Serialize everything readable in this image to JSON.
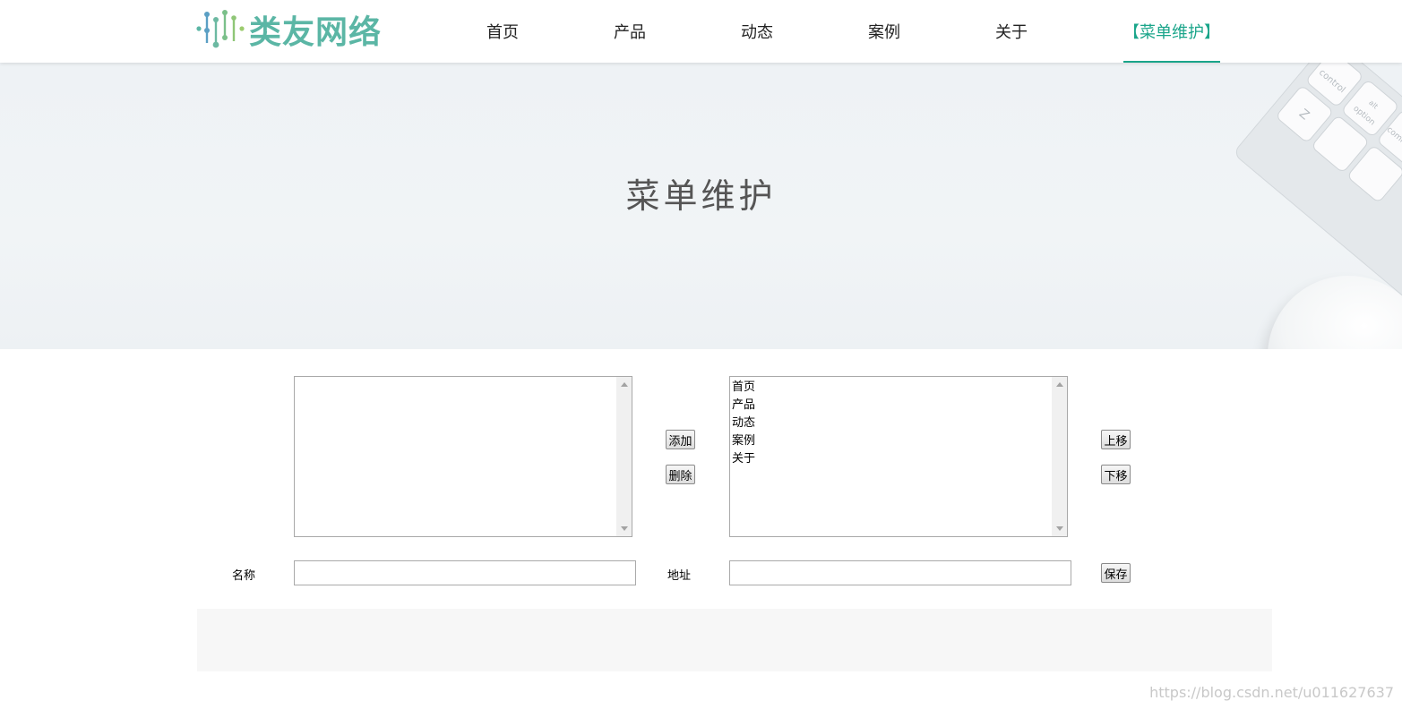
{
  "header": {
    "logo_text": "类友网络",
    "nav": [
      {
        "label": "首页",
        "active": false
      },
      {
        "label": "产品",
        "active": false
      },
      {
        "label": "动态",
        "active": false
      },
      {
        "label": "案例",
        "active": false
      },
      {
        "label": "关于",
        "active": false
      },
      {
        "label": "【菜单维护】",
        "active": true
      }
    ],
    "accent_color": "#1aa58a"
  },
  "banner": {
    "title": "菜单维护",
    "keyboard_keys": [
      "control",
      "alt",
      "option",
      "command",
      "Z"
    ]
  },
  "form": {
    "left_list_items": [],
    "right_list_items": [
      "首页",
      "产品",
      "动态",
      "案例",
      "关于"
    ],
    "add_button": "添加",
    "delete_button": "删除",
    "move_up_button": "上移",
    "move_down_button": "下移",
    "name_label": "名称",
    "name_value": "",
    "address_label": "地址",
    "address_value": "",
    "save_button": "保存"
  },
  "watermark": "https://blog.csdn.net/u011627637"
}
